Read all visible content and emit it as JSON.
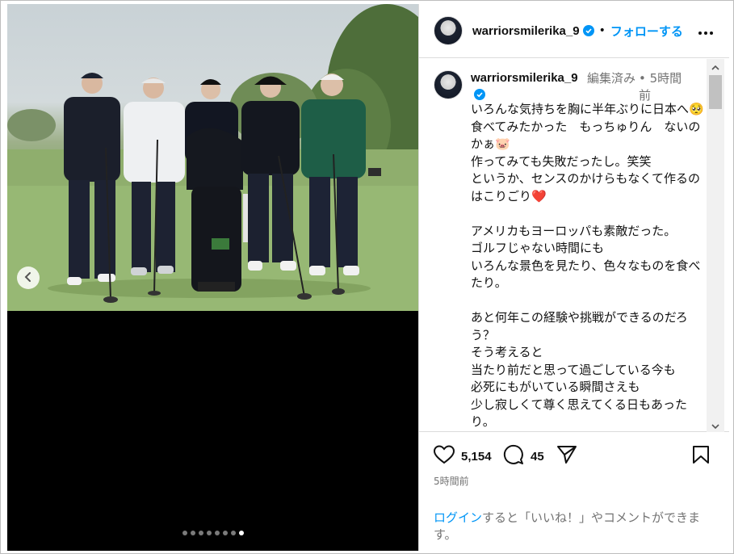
{
  "post": {
    "username": "warriorsmilerika_9",
    "follow_label": "フォローする",
    "header_separator": "•",
    "edited_label": "編集済み",
    "meta_separator": "•",
    "time_ago": "5時間前",
    "caption": "いろんな気持ちを胸に半年ぶりに日本へ🥺\n食べてみたかった　もっちゅりん　ないのかぁ🐷\n作ってみても失敗だったし。笑笑\nというか、センスのかけらもなくて作るのはこりごり❤️\n\nアメリカもヨーロッパも素敵だった。\nゴルフじゃない時間にも\nいろんな景色を見たり、色々なものを食べたり。\n\nあと何年この経験や挑戦ができるのだろう？\nそう考えると\n当たり前だと思って過ごしている今も\n必死にもがいている瞬間さえも\n少し寂しくて尊く思えてくる日もあったり。",
    "likes": "5,154",
    "comments": "45",
    "posted_time": "5時間前",
    "login_link": "ログイン",
    "login_rest": "すると「いいね！」やコメントができます。"
  },
  "carousel": {
    "dot_count": 8,
    "active_index": 7
  },
  "colors": {
    "link_blue": "#0095f6",
    "secondary_text": "#737373",
    "divider": "#dbdbdb"
  },
  "icons": [
    "verified-badge-icon",
    "more-options-icon",
    "chevron-left-icon",
    "heart-icon",
    "comment-icon",
    "share-icon",
    "bookmark-icon"
  ]
}
